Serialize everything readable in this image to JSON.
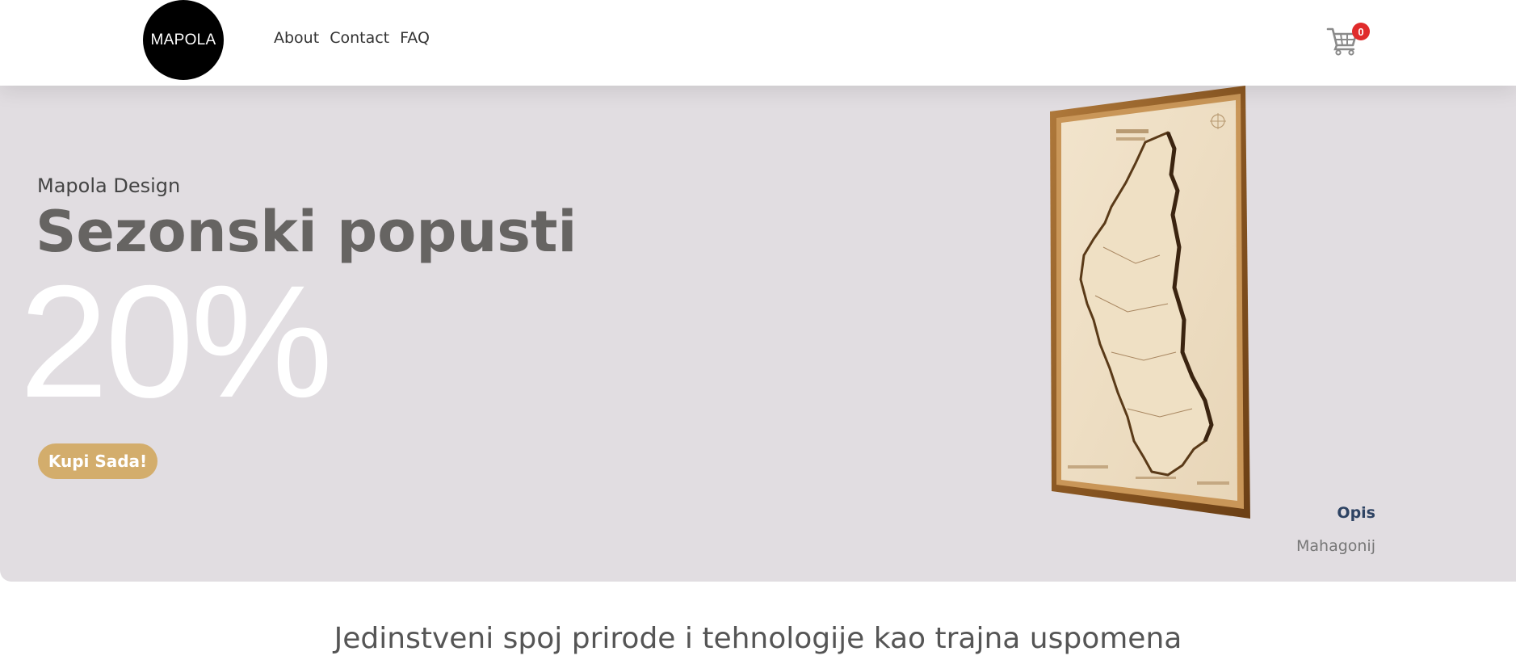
{
  "header": {
    "logo_text": "MAPOLA",
    "nav": [
      {
        "label": "About"
      },
      {
        "label": "Contact"
      },
      {
        "label": "FAQ"
      }
    ],
    "cart_count": "0"
  },
  "hero": {
    "subtitle": "Mapola Design",
    "title": "Sezonski popusti",
    "discount": "20%",
    "button_label": "Kupi Sada!",
    "description_label": "Opis",
    "material": "Mahagonij",
    "image": "framed wooden relief map"
  },
  "tagline": "Jedinstveni spoj prirode i tehnologije kao trajna uspomena",
  "colors": {
    "hero_bg": "#e1dde1",
    "button": "#d3ad6c",
    "badge": "#e02b2b",
    "opis": "#2e4363"
  }
}
